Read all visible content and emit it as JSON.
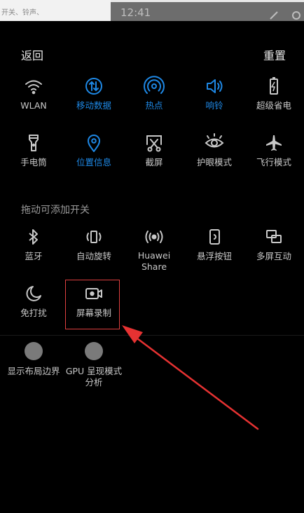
{
  "background_app": {
    "text": "开关、铃声、",
    "time": "12:41"
  },
  "header": {
    "back_label": "返回",
    "reset_label": "重置"
  },
  "active_tiles": [
    {
      "label": "WLAN",
      "icon": "wifi-icon",
      "active": false
    },
    {
      "label": "移动数据",
      "icon": "mobile-data-icon",
      "active": true
    },
    {
      "label": "热点",
      "icon": "hotspot-icon",
      "active": true
    },
    {
      "label": "响铃",
      "icon": "ring-icon",
      "active": true
    },
    {
      "label": "超级省电",
      "icon": "battery-saver-icon",
      "active": false
    },
    {
      "label": "手电筒",
      "icon": "flashlight-icon",
      "active": false
    },
    {
      "label": "位置信息",
      "icon": "location-icon",
      "active": true
    },
    {
      "label": "截屏",
      "icon": "screenshot-icon",
      "active": false
    },
    {
      "label": "护眼模式",
      "icon": "eye-icon",
      "active": false
    },
    {
      "label": "飞行模式",
      "icon": "airplane-icon",
      "active": false
    }
  ],
  "drag_section": {
    "title": "拖动可添加开关",
    "tiles": [
      {
        "label": "蓝牙",
        "icon": "bluetooth-icon"
      },
      {
        "label": "自动旋转",
        "icon": "auto-rotate-icon"
      },
      {
        "label": "Huawei Share",
        "icon": "huawei-share-icon"
      },
      {
        "label": "悬浮按钮",
        "icon": "floating-button-icon"
      },
      {
        "label": "多屏互动",
        "icon": "multi-screen-icon"
      },
      {
        "label": "免打扰",
        "icon": "do-not-disturb-icon"
      },
      {
        "label": "屏幕录制",
        "icon": "screen-record-icon"
      }
    ]
  },
  "developer_tiles": [
    {
      "label": "显示布局边界",
      "icon": "circle-icon"
    },
    {
      "label": "GPU 呈现模式分析",
      "icon": "circle-icon"
    }
  ],
  "colors": {
    "active_blue": "#1e88e5",
    "inactive_gray": "#c8c8c8",
    "highlight_red": "#e04040"
  }
}
